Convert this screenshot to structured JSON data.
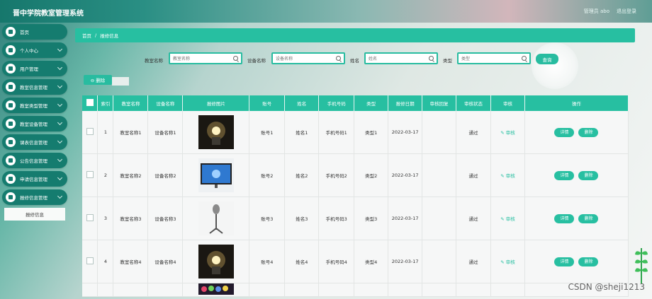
{
  "app": {
    "title": "晋中学院教室管理系统",
    "admin_label": "管理员 abo",
    "logout": "退出登录"
  },
  "sidebar": {
    "items": [
      {
        "label": "首页"
      },
      {
        "label": "个人中心"
      },
      {
        "label": "用户管理"
      },
      {
        "label": "教室信息管理"
      },
      {
        "label": "教室类型管理"
      },
      {
        "label": "教室设备管理"
      },
      {
        "label": "课表信息管理"
      },
      {
        "label": "公告信息管理"
      },
      {
        "label": "申请信息管理"
      },
      {
        "label": "报修信息管理"
      }
    ],
    "sub_item": "报修信息"
  },
  "breadcrumb": {
    "home": "首页",
    "separator": "/",
    "current": "报修信息"
  },
  "search": {
    "classroom_label": "教室名称",
    "classroom_placeholder": "教室名称",
    "device_label": "设备名称",
    "device_placeholder": "设备名称",
    "name_label": "姓名",
    "name_placeholder": "姓名",
    "type_label": "类型",
    "type_placeholder": "类型",
    "query_button": "查询"
  },
  "toolbar": {
    "delete_button": "⊖ 删除"
  },
  "table": {
    "headers": [
      "索引",
      "教室名称",
      "设备名称",
      "报修图片",
      "账号",
      "姓名",
      "手机号码",
      "类型",
      "报修日期",
      "审核回复",
      "审核状态",
      "审核",
      "操作"
    ],
    "rows": [
      {
        "index": "1",
        "classroom": "教室名称1",
        "device": "设备名称1",
        "account": "账号1",
        "name": "姓名1",
        "phone": "手机号码1",
        "type": "类型1",
        "date": "2022-03-17",
        "reply": "",
        "status": "通过",
        "audit": "✎ 审核"
      },
      {
        "index": "2",
        "classroom": "教室名称2",
        "device": "设备名称2",
        "account": "账号2",
        "name": "姓名2",
        "phone": "手机号码2",
        "type": "类型2",
        "date": "2022-03-17",
        "reply": "",
        "status": "通过",
        "audit": "✎ 审核"
      },
      {
        "index": "3",
        "classroom": "教室名称3",
        "device": "设备名称3",
        "account": "账号3",
        "name": "姓名3",
        "phone": "手机号码3",
        "type": "类型3",
        "date": "2022-03-17",
        "reply": "",
        "status": "通过",
        "audit": "✎ 审核"
      },
      {
        "index": "4",
        "classroom": "教室名称4",
        "device": "设备名称4",
        "account": "账号4",
        "name": "姓名4",
        "phone": "手机号码4",
        "type": "类型4",
        "date": "2022-03-17",
        "reply": "",
        "status": "通过",
        "audit": "✎ 审核"
      }
    ],
    "actions": {
      "detail": "详情",
      "delete": "删除"
    }
  },
  "watermark": "CSDN @sheji1213",
  "colors": {
    "accent": "#27bfa1",
    "nav": "#157c6f"
  }
}
